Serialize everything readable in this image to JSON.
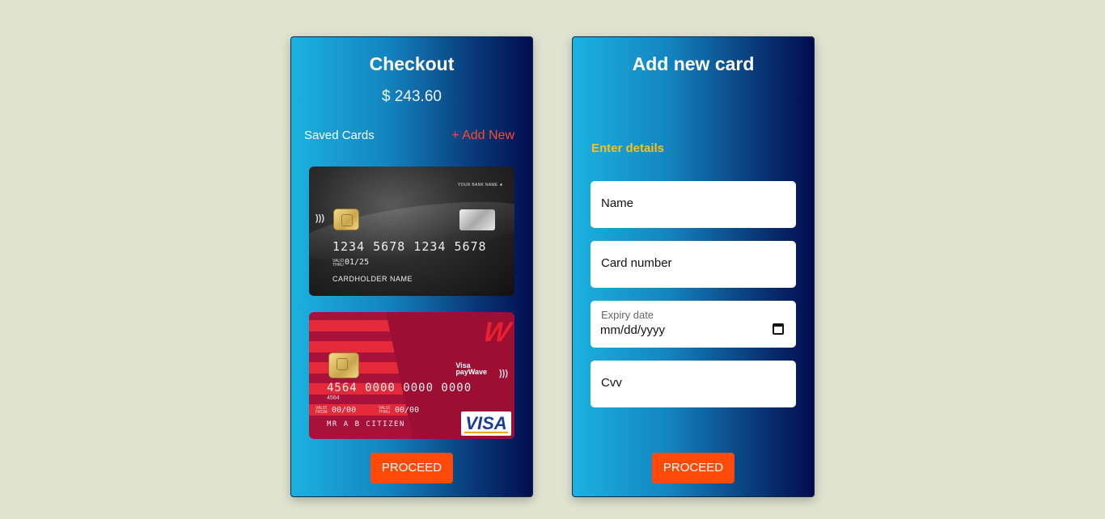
{
  "checkout": {
    "title": "Checkout",
    "amount": "$ 243.60",
    "saved_cards_label": "Saved Cards",
    "add_new_label": "+ Add New",
    "cards": [
      {
        "bank_name": "YOUR BANK NAME ★",
        "number": "1234  5678  1234  5678",
        "valid_thru_label": "VALID THRU",
        "expiry": "01/25",
        "holder": "CARDHOLDER NAME"
      },
      {
        "number": "4564  0000  0000  0000",
        "number_small": "4564",
        "valid_from_label": "VALID FROM",
        "valid_from": "00/00",
        "valid_thru_label": "VALID THRU",
        "valid_thru": "00/00",
        "holder": "MR A B CITIZEN",
        "paywave_brand": "Visa",
        "paywave_label": "payWave",
        "network": "VISA"
      }
    ],
    "proceed_label": "PROCEED"
  },
  "add_card": {
    "title": "Add new card",
    "enter_details_label": "Enter details",
    "name_placeholder": "Name",
    "card_number_placeholder": "Card number",
    "expiry_label": "Expiry date",
    "expiry_placeholder": "mm/dd/yyyy",
    "cvv_placeholder": "Cvv",
    "proceed_label": "PROCEED"
  },
  "colors": {
    "background": "#e1e3d1",
    "accent_button": "#ff4a0a",
    "add_new_link": "#ff4a2a",
    "enter_details": "#f5c020"
  }
}
